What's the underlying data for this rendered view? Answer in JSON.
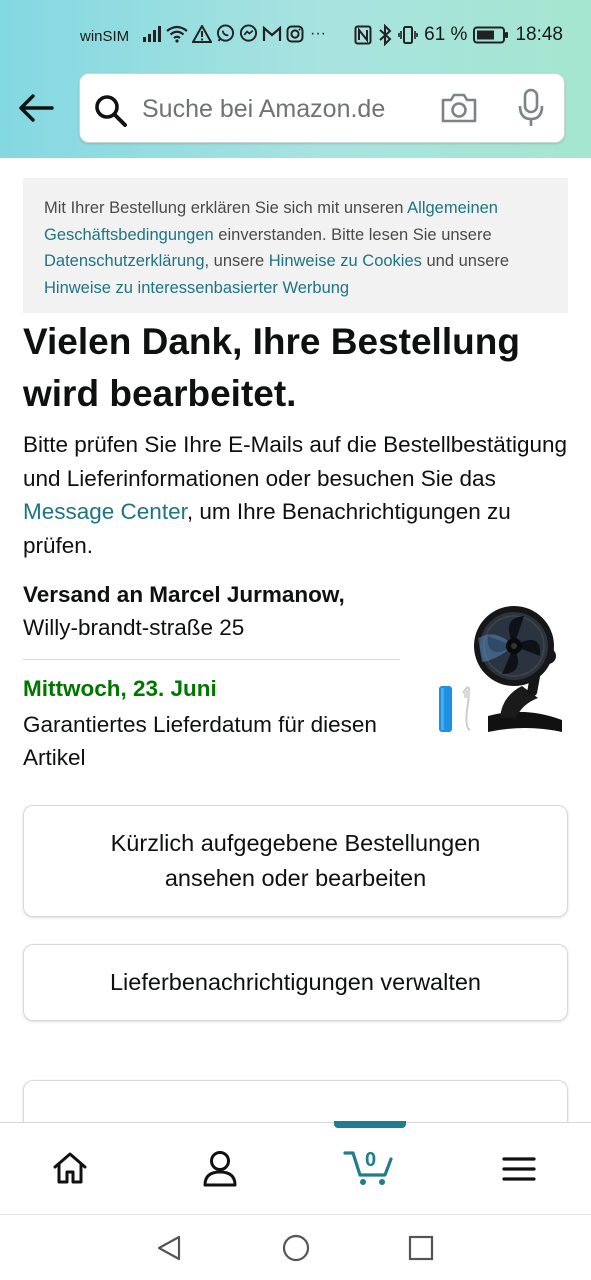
{
  "status_bar": {
    "carrier": "winSIM",
    "more_indicator": "···",
    "battery_percent": "61 %",
    "time": "18:48",
    "icons": [
      "signal-icon",
      "wifi-icon",
      "warning-icon",
      "whatsapp-icon",
      "messenger-icon",
      "gmail-icon",
      "instagram-icon",
      "nfc-icon",
      "bluetooth-icon",
      "vibrate-icon",
      "battery-icon"
    ]
  },
  "search": {
    "placeholder": "Suche bei Amazon.de",
    "value": ""
  },
  "notice": {
    "text1": "Mit Ihrer Bestellung erklären Sie sich mit unseren ",
    "link_terms": "Allgemeinen Geschäftsbedingungen",
    "text2": " einverstanden. Bitte lesen Sie unsere ",
    "link_privacy": "Datenschutzerklärung",
    "text3": ", unsere ",
    "link_cookies": "Hinweise zu Cookies",
    "text4": " und unsere ",
    "link_ads": "Hinweise zu interessenbasierter Werbung"
  },
  "confirmation": {
    "headline": "Vielen Dank, Ihre Bestellung wird bearbeitet.",
    "intro_text1": "Bitte prüfen Sie Ihre E-Mails auf die Bestellbestätigung und Lieferinformationen oder besuchen Sie das ",
    "intro_link": "Message Center",
    "intro_text2": ", um Ihre Benachrichtigungen zu prüfen."
  },
  "shipping": {
    "name": "Versand an Marcel Jurmanow,",
    "street": "Willy-brandt-straße 25",
    "delivery_date": "Mittwoch, 23. Juni",
    "delivery_text": "Garantiertes Lieferdatum für diesen Artikel"
  },
  "buttons": {
    "recent_orders": "Kürzlich aufgegebene Bestellungen ansehen oder bearbeiten",
    "delivery_notifications": "Lieferbenachrichtigungen verwalten"
  },
  "bottom_nav": {
    "cart_count": "0",
    "active_tab": "cart",
    "accent_color": "#1f7d8c"
  },
  "colors": {
    "link": "#1d7584",
    "delivery_green": "#007600",
    "header_gradient_start": "#84d8e1",
    "header_gradient_end": "#a5e6cf"
  }
}
